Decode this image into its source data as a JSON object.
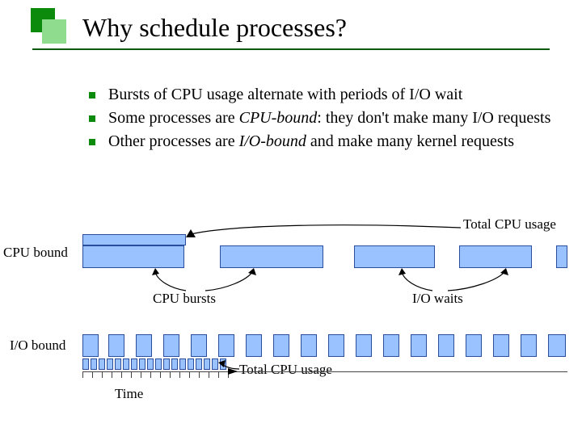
{
  "title": "Why schedule processes?",
  "bullets": [
    {
      "pre": "Bursts of CPU usage alternate with periods of I/O wait",
      "em": "",
      "post": ""
    },
    {
      "pre": "Some processes are ",
      "em": "CPU-bound",
      "post": ": they don't make many I/O requests"
    },
    {
      "pre": "Other processes are ",
      "em": "I/O-bound",
      "post": " and make many kernel requests"
    }
  ],
  "labels": {
    "total_cpu": "Total CPU usage",
    "cpu_bound": "CPU bound",
    "cpu_bursts": "CPU bursts",
    "io_waits": "I/O waits",
    "io_bound": "I/O bound",
    "time": "Time"
  },
  "chart_data": {
    "type": "bar",
    "axis_range": [
      0,
      600
    ],
    "tracks": [
      {
        "name": "cpu_bound_total",
        "bars": [
          [
            0,
            126
          ]
        ]
      },
      {
        "name": "cpu_bound_timeline",
        "bars": [
          [
            0,
            126
          ],
          [
            170,
            128
          ],
          [
            336,
            100
          ],
          [
            466,
            90
          ],
          [
            586,
            14
          ]
        ]
      },
      {
        "name": "io_bound_timeline",
        "bars": [
          [
            0,
            20
          ],
          [
            32,
            20
          ],
          [
            66,
            20
          ],
          [
            100,
            20
          ],
          [
            134,
            20
          ],
          [
            168,
            20
          ],
          [
            202,
            20
          ],
          [
            236,
            20
          ],
          [
            270,
            20
          ],
          [
            304,
            20
          ],
          [
            338,
            20
          ],
          [
            372,
            20
          ],
          [
            406,
            20
          ],
          [
            440,
            20
          ],
          [
            474,
            20
          ],
          [
            508,
            20
          ],
          [
            542,
            20
          ],
          [
            576,
            22
          ]
        ]
      },
      {
        "name": "io_bound_total",
        "bars": [
          [
            0,
            8
          ],
          [
            10,
            8
          ],
          [
            20,
            8
          ],
          [
            30,
            8
          ],
          [
            40,
            8
          ],
          [
            50,
            8
          ],
          [
            60,
            8
          ],
          [
            70,
            8
          ],
          [
            80,
            8
          ],
          [
            90,
            8
          ],
          [
            100,
            8
          ],
          [
            110,
            8
          ],
          [
            120,
            8
          ],
          [
            130,
            8
          ],
          [
            140,
            8
          ],
          [
            150,
            8
          ],
          [
            160,
            8
          ],
          [
            170,
            8
          ]
        ]
      }
    ],
    "labels": {
      "x": "Time"
    }
  }
}
